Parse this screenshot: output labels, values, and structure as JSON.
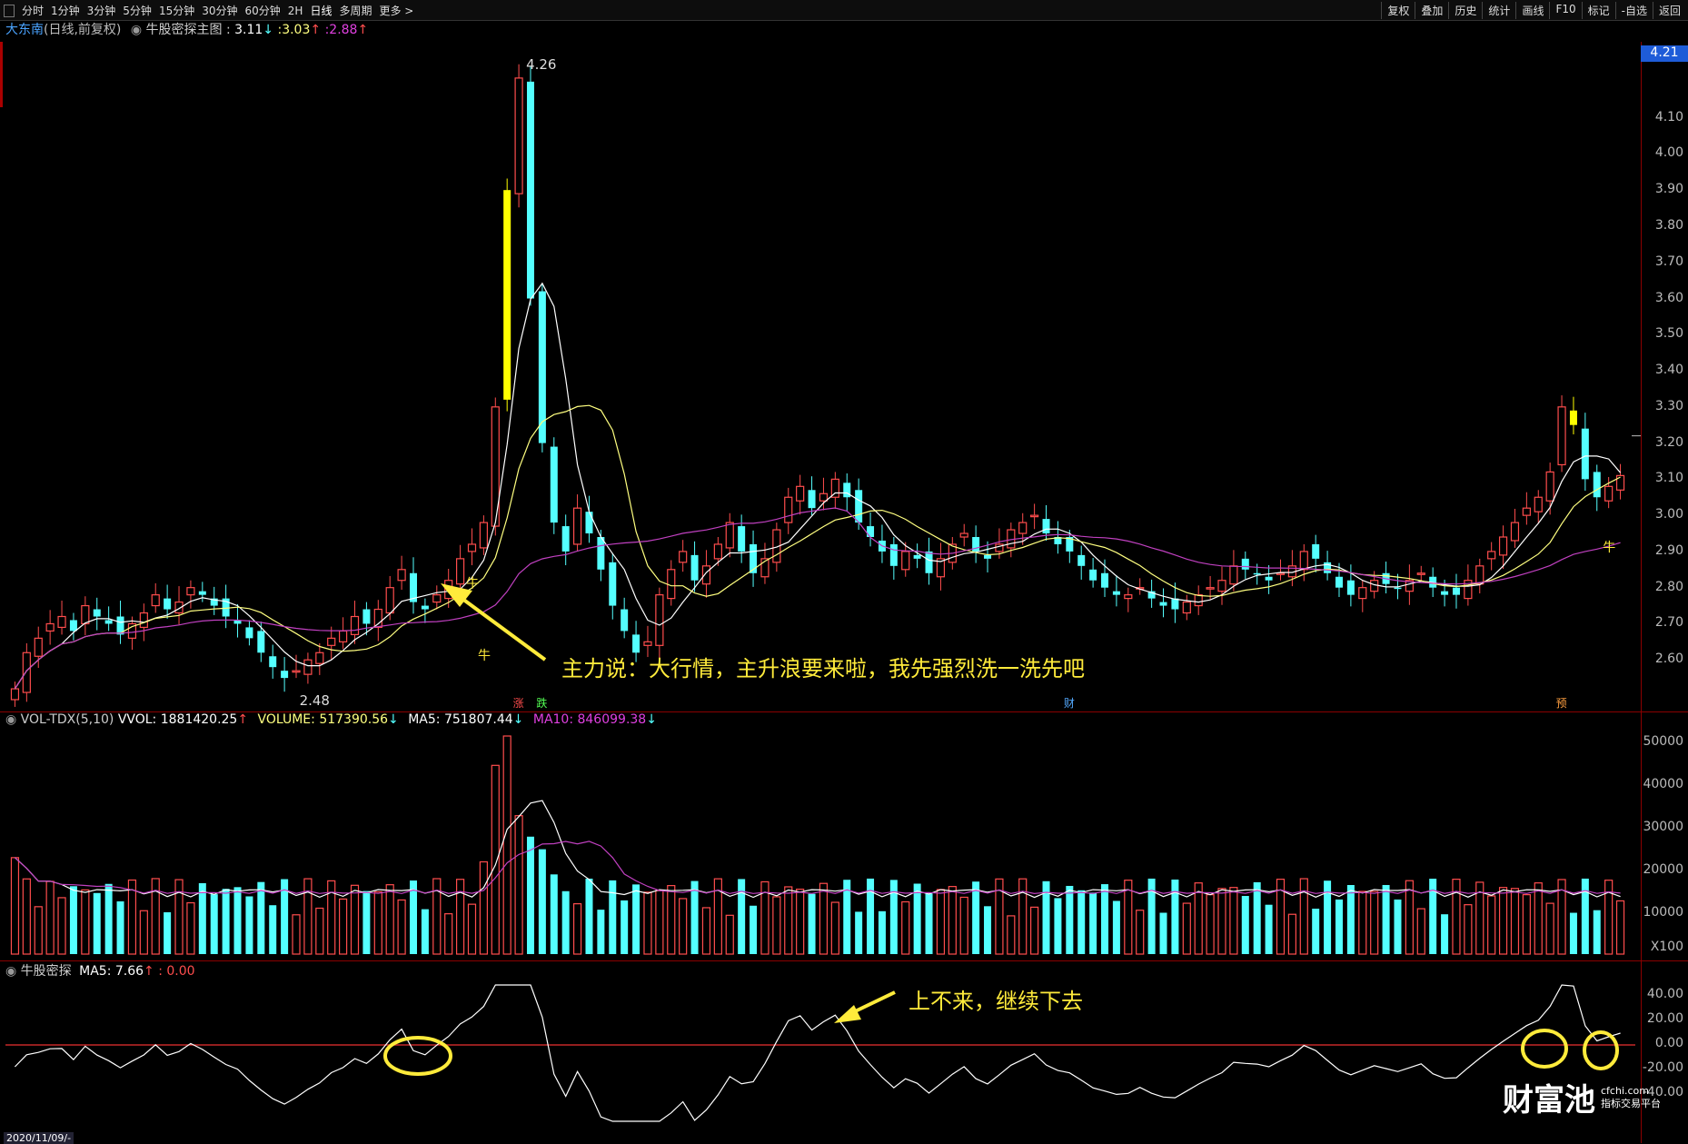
{
  "toolbar": {
    "periods": [
      "分时",
      "1分钟",
      "3分钟",
      "5分钟",
      "15分钟",
      "30分钟",
      "60分钟",
      "2H",
      "日线",
      "多周期",
      "更多 >"
    ],
    "right_buttons": [
      "复权",
      "叠加",
      "历史",
      "统计",
      "画线",
      "F10",
      "标记",
      "-自选",
      "返回"
    ]
  },
  "main_panel": {
    "stock_name": "大东南",
    "period_label": "(日线,前复权)",
    "indicator_name": "牛股密探主图 :",
    "v1": "3.11",
    "v1_arrow": "↓",
    "v2": "3.03",
    "v2_arrow": "↑",
    "v3": "2.88",
    "v3_arrow": "↑",
    "price_ticks": [
      "4.10",
      "4.00",
      "3.90",
      "3.80",
      "3.70",
      "3.60",
      "3.50",
      "3.40",
      "3.30",
      "3.20",
      "3.10",
      "3.00",
      "2.90",
      "2.80",
      "2.70",
      "2.60"
    ],
    "current_price_badge": "4.21",
    "high_label": "4.26",
    "low_label": "2.48",
    "niu_label": "牛",
    "event_marks": [
      "涨",
      "跌",
      "财",
      "预"
    ]
  },
  "volume_panel": {
    "title": "VOL-TDX(5,10)",
    "vvol": "VVOL: 1881420.25",
    "vvol_arrow": "↑",
    "volume": "VOLUME: 517390.56",
    "volume_arrow": "↓",
    "ma5": "MA5: 751807.44",
    "ma5_arrow": "↓",
    "ma10": "MA10: 846099.38",
    "ma10_arrow": "↓",
    "ticks": [
      "50000",
      "40000",
      "30000",
      "20000",
      "10000"
    ],
    "multiplier": "X100"
  },
  "osc_panel": {
    "title": "牛股密探",
    "ma5": "MA5: 7.66",
    "ma5_arrow": "↑",
    "value": ": 0.00",
    "ticks": [
      "40.00",
      "20.00",
      "0.00",
      "-20.00",
      "-40.00"
    ]
  },
  "annotations": {
    "main_text": "主力说：大行情，主升浪要来啦，我先强烈洗一洗先吧",
    "osc_text": "上不来，继续下去"
  },
  "footer": {
    "date_label": "2020/11/09/-"
  },
  "logo": {
    "name": "财富池",
    "domain": "cfchi.com",
    "tagline": "指标交易平台"
  },
  "colors": {
    "up": "#ff4d4d",
    "down": "#54ffff",
    "yellow": "#ffff00",
    "ma_white": "#ffffff",
    "ma_yellow": "#ffff80",
    "ma_purple": "#c040c0"
  },
  "chart_data": {
    "type": "candlestick",
    "ylim": [
      2.5,
      4.26
    ],
    "closes": [
      2.52,
      2.62,
      2.66,
      2.7,
      2.72,
      2.68,
      2.75,
      2.72,
      2.7,
      2.67,
      2.7,
      2.73,
      2.78,
      2.74,
      2.76,
      2.8,
      2.78,
      2.75,
      2.72,
      2.7,
      2.66,
      2.62,
      2.58,
      2.55,
      2.57,
      2.6,
      2.62,
      2.66,
      2.68,
      2.72,
      2.7,
      2.74,
      2.8,
      2.85,
      2.76,
      2.74,
      2.78,
      2.82,
      2.88,
      2.92,
      2.98,
      3.3,
      3.9,
      4.21,
      3.6,
      3.2,
      2.98,
      2.9,
      3.02,
      2.95,
      2.85,
      2.75,
      2.68,
      2.62,
      2.65,
      2.78,
      2.85,
      2.9,
      2.82,
      2.86,
      2.92,
      2.98,
      2.9,
      2.84,
      2.88,
      2.96,
      3.05,
      3.08,
      3.02,
      3.06,
      3.1,
      3.05,
      2.98,
      2.94,
      2.9,
      2.86,
      2.9,
      2.88,
      2.84,
      2.88,
      2.92,
      2.95,
      2.9,
      2.88,
      2.92,
      2.96,
      2.98,
      3.0,
      2.95,
      2.92,
      2.9,
      2.86,
      2.82,
      2.8,
      2.78,
      2.78,
      2.8,
      2.77,
      2.75,
      2.74,
      2.76,
      2.78,
      2.8,
      2.82,
      2.86,
      2.85,
      2.84,
      2.82,
      2.84,
      2.86,
      2.9,
      2.88,
      2.84,
      2.8,
      2.78,
      2.8,
      2.82,
      2.81,
      2.8,
      2.82,
      2.84,
      2.8,
      2.78,
      2.78,
      2.82,
      2.86,
      2.9,
      2.94,
      2.98,
      3.02,
      3.05,
      3.12,
      3.3,
      3.25,
      3.1,
      3.05,
      3.08,
      3.11
    ]
  }
}
